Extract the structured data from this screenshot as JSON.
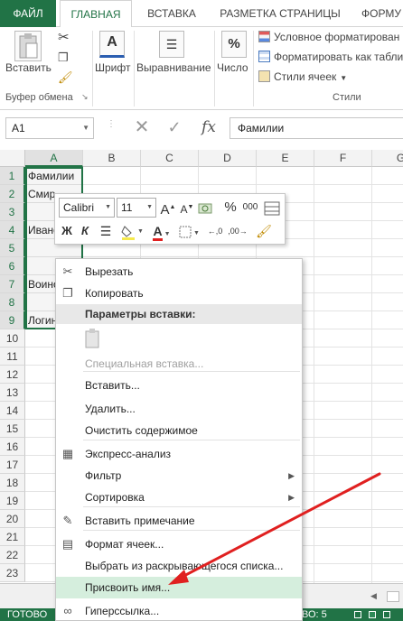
{
  "ribbon_tabs": [
    "ФАЙЛ",
    "ГЛАВНАЯ",
    "ВСТАВКА",
    "РАЗМЕТКА СТРАНИЦЫ",
    "ФОРМУ"
  ],
  "ribbon": {
    "paste_label": "Вставить",
    "clipboard_group": "Буфер обмена",
    "font_label": "Шрифт",
    "alignment_label": "Выравнивание",
    "number_label": "Число",
    "percent_symbol": "%",
    "conditional_formatting": "Условное форматирован",
    "format_as_table": "Форматировать как табли",
    "cell_styles": "Стили ячеек",
    "styles_group": "Стили"
  },
  "formula_bar": {
    "name_box": "A1",
    "fx_label": "fx",
    "content": "Фамилии"
  },
  "grid": {
    "columns": [
      "A",
      "B",
      "C",
      "D",
      "E",
      "F",
      "G"
    ],
    "rows": [
      "1",
      "2",
      "3",
      "4",
      "5",
      "6",
      "7",
      "8",
      "9",
      "10",
      "11",
      "12",
      "13",
      "14",
      "15",
      "16",
      "17",
      "18",
      "19",
      "20",
      "21",
      "22",
      "23"
    ],
    "cells": [
      {
        "row": 1,
        "text": "Фамилии"
      },
      {
        "row": 2,
        "text": "Смирнов"
      },
      {
        "row": 4,
        "text": "Иванов"
      },
      {
        "row": 7,
        "text": "Воинов"
      },
      {
        "row": 9,
        "text": "Логинов"
      }
    ]
  },
  "mini_toolbar": {
    "font_name": "Calibri",
    "font_size": "11",
    "bold": "Ж",
    "italic": "К",
    "percent": "%",
    "thousands": "000"
  },
  "context_menu": {
    "items": [
      {
        "label": "Вырезать",
        "icon": "scissors-icon"
      },
      {
        "label": "Копировать",
        "icon": "copy-icon"
      },
      {
        "label": "Параметры вставки:",
        "section": true
      },
      {
        "label": "Специальная вставка...",
        "disabled": true
      },
      {
        "label": "Вставить..."
      },
      {
        "label": "Удалить..."
      },
      {
        "label": "Очистить содержимое"
      },
      {
        "label": "Экспресс-анализ",
        "icon": "quick-analysis-icon"
      },
      {
        "label": "Фильтр",
        "submenu": true
      },
      {
        "label": "Сортировка",
        "submenu": true
      },
      {
        "label": "Вставить примечание",
        "icon": "comment-icon"
      },
      {
        "label": "Формат ячеек...",
        "icon": "format-cells-icon"
      },
      {
        "label": "Выбрать из раскрывающегося списка..."
      },
      {
        "label": "Присвоить имя...",
        "highlighted": true
      },
      {
        "label": "Гиперссылка...",
        "icon": "hyperlink-icon"
      }
    ]
  },
  "status_bar": {
    "ready": "ГОТОВО",
    "count_fragment": "ВО: 5"
  },
  "colors": {
    "accent": "#217346",
    "highlight": "#d5eedd",
    "annotation_arrow": "#e02020"
  }
}
